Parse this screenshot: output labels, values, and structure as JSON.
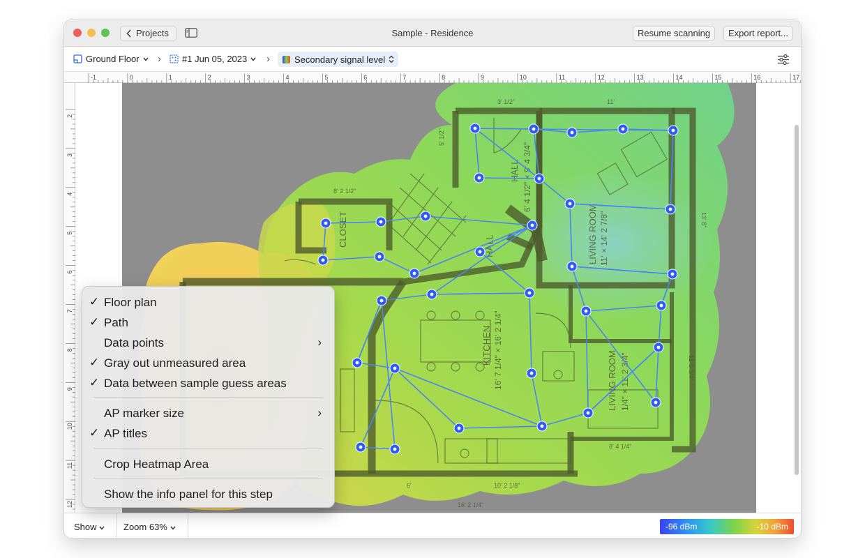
{
  "window": {
    "title": "Sample - Residence"
  },
  "toolbar": {
    "back_label": "Projects",
    "resume_label": "Resume scanning",
    "export_label": "Export report..."
  },
  "pathbar": {
    "floor": "Ground Floor",
    "scan": "#1 Jun 05, 2023",
    "visualization": "Secondary signal level"
  },
  "ruler": {
    "top_ticks": [
      "-1",
      "0",
      "1",
      "2",
      "3",
      "4",
      "5",
      "6",
      "7",
      "8",
      "9",
      "10",
      "11",
      "12",
      "13",
      "14",
      "15",
      "16",
      "17"
    ],
    "left_ticks": [
      "2",
      "3",
      "4",
      "5",
      "6",
      "7",
      "8",
      "9",
      "10",
      "11",
      "12"
    ]
  },
  "floorplan": {
    "rooms": {
      "living": "LIVING ROOM",
      "living_size": "11' × 14' 2 7/8\"",
      "kitchen": "KITCHEN",
      "kitchen_size": "16' 7 1/4\" × 16' 2 1/4\"",
      "hall": "HALL",
      "hall_size": "6' 4 1/2\" × 9' 4 3/4\"",
      "hall2": "HALL",
      "closet": "CLOSET",
      "living2": "LIVING ROOM",
      "living2_size": "1/4\" × 11' 2 3/4\""
    },
    "dimensions": {
      "d1": "11'",
      "d2": "8' 2 1/2\"",
      "d3": "13' 8\"",
      "d4": "10' 2 1/8\"",
      "d5": "16' 2 1/4\"",
      "d6": "8' 4 1/4\"",
      "d7": "11' 2 3/4\"",
      "d8": "3' 1/2\"",
      "d9": "5' 1/2\"",
      "d10": "6'"
    }
  },
  "menu": {
    "items": [
      {
        "label": "Floor plan",
        "checked": true
      },
      {
        "label": "Path",
        "checked": true
      },
      {
        "label": "Data points",
        "checked": false,
        "submenu": true
      },
      {
        "label": "Gray out unmeasured area",
        "checked": true
      },
      {
        "label": "Data between sample guess areas",
        "checked": true
      },
      {
        "label": "AP marker size",
        "checked": false,
        "submenu": true
      },
      {
        "label": "AP titles",
        "checked": true
      },
      {
        "label": "Crop Heatmap Area",
        "checked": false
      },
      {
        "label": "Show the info panel for this step",
        "checked": false
      }
    ],
    "check_glyph": "✓",
    "submenu_glyph": "›"
  },
  "bottombar": {
    "show_label": "Show",
    "zoom_label": "Zoom 63%",
    "legend_min": "-96 dBm",
    "legend_max": "-10 dBm"
  },
  "colors": {
    "accent": "#2f5cf5",
    "path": "#4a86f0",
    "signal_strong": "#ee4c2e",
    "signal_weak": "#3a43f0"
  }
}
